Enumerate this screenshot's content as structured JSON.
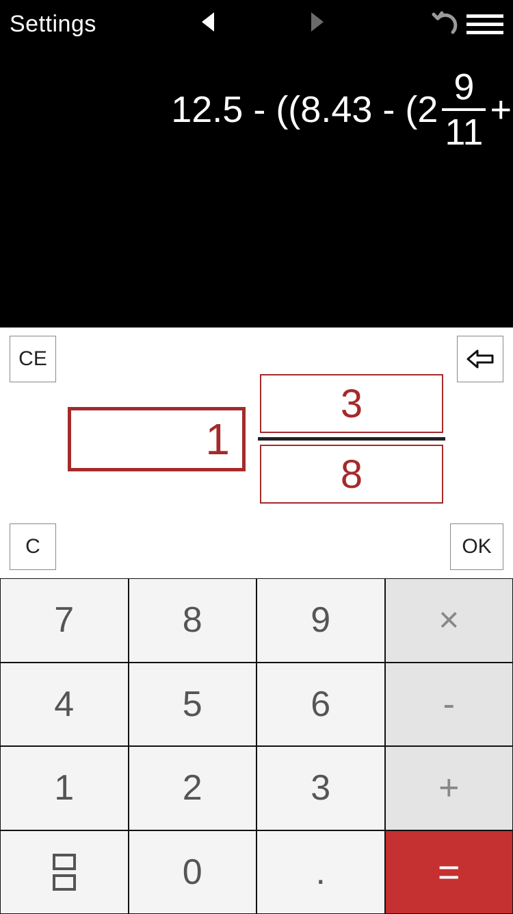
{
  "navbar": {
    "settings_label": "Settings"
  },
  "expression": {
    "head": "12.5 - ((8.43 - (2",
    "numerator": "9",
    "denominator": "11",
    "tail": " + "
  },
  "middle": {
    "ce_label": "CE",
    "c_label": "C",
    "ok_label": "OK",
    "whole": "1",
    "numerator": "3",
    "denominator": "8"
  },
  "keypad": {
    "k7": "7",
    "k8": "8",
    "k9": "9",
    "mult": "×",
    "k4": "4",
    "k5": "5",
    "k6": "6",
    "minus": "-",
    "k1": "1",
    "k2": "2",
    "k3": "3",
    "plus": "+",
    "k0": "0",
    "dot": ".",
    "eq": "="
  }
}
